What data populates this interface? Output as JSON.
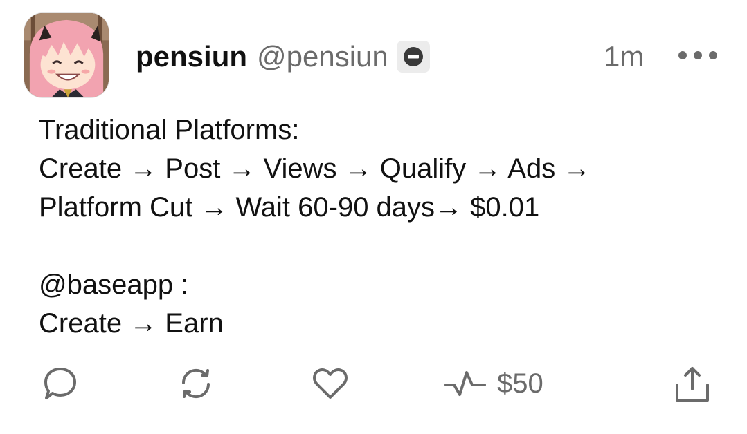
{
  "post": {
    "author": {
      "display_name": "pensiun",
      "handle": "@pensiun",
      "avatar_icon": "avatar-icon",
      "badge_icon": "minus-circle-icon"
    },
    "timestamp": "1m",
    "more_icon": "more-horizontal-icon",
    "lines": [
      "Traditional Platforms:",
      "Create → Post → Views → Qualify → Ads →",
      "Platform Cut → Wait 60-90 days→ $0.01",
      "",
      "@baseapp :",
      "Create → Earn"
    ]
  },
  "actions": {
    "reply_icon": "comment-icon",
    "recast_icon": "recast-icon",
    "like_icon": "heart-icon",
    "tips_icon": "activity-icon",
    "tips_amount": "$50",
    "share_icon": "share-icon"
  },
  "colors": {
    "text_primary": "#111111",
    "text_secondary": "#6b6b6b",
    "icon": "#6b6b6b",
    "badge_bg": "#ececec",
    "background": "#ffffff"
  }
}
